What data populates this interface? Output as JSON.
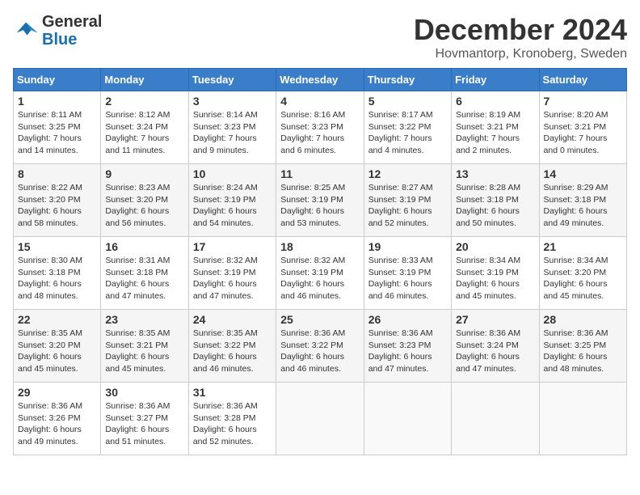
{
  "header": {
    "logo_general": "General",
    "logo_blue": "Blue",
    "month_title": "December 2024",
    "location": "Hovmantorp, Kronoberg, Sweden"
  },
  "days_of_week": [
    "Sunday",
    "Monday",
    "Tuesday",
    "Wednesday",
    "Thursday",
    "Friday",
    "Saturday"
  ],
  "weeks": [
    [
      {
        "day": "1",
        "sunrise": "8:11 AM",
        "sunset": "3:25 PM",
        "daylight_hours": "7",
        "daylight_minutes": "14"
      },
      {
        "day": "2",
        "sunrise": "8:12 AM",
        "sunset": "3:24 PM",
        "daylight_hours": "7",
        "daylight_minutes": "11"
      },
      {
        "day": "3",
        "sunrise": "8:14 AM",
        "sunset": "3:23 PM",
        "daylight_hours": "7",
        "daylight_minutes": "9"
      },
      {
        "day": "4",
        "sunrise": "8:16 AM",
        "sunset": "3:23 PM",
        "daylight_hours": "7",
        "daylight_minutes": "6"
      },
      {
        "day": "5",
        "sunrise": "8:17 AM",
        "sunset": "3:22 PM",
        "daylight_hours": "7",
        "daylight_minutes": "4"
      },
      {
        "day": "6",
        "sunrise": "8:19 AM",
        "sunset": "3:21 PM",
        "daylight_hours": "7",
        "daylight_minutes": "2"
      },
      {
        "day": "7",
        "sunrise": "8:20 AM",
        "sunset": "3:21 PM",
        "daylight_hours": "7",
        "daylight_minutes": "0"
      }
    ],
    [
      {
        "day": "8",
        "sunrise": "8:22 AM",
        "sunset": "3:20 PM",
        "daylight_hours": "6",
        "daylight_minutes": "58"
      },
      {
        "day": "9",
        "sunrise": "8:23 AM",
        "sunset": "3:20 PM",
        "daylight_hours": "6",
        "daylight_minutes": "56"
      },
      {
        "day": "10",
        "sunrise": "8:24 AM",
        "sunset": "3:19 PM",
        "daylight_hours": "6",
        "daylight_minutes": "54"
      },
      {
        "day": "11",
        "sunrise": "8:25 AM",
        "sunset": "3:19 PM",
        "daylight_hours": "6",
        "daylight_minutes": "53"
      },
      {
        "day": "12",
        "sunrise": "8:27 AM",
        "sunset": "3:19 PM",
        "daylight_hours": "6",
        "daylight_minutes": "52"
      },
      {
        "day": "13",
        "sunrise": "8:28 AM",
        "sunset": "3:18 PM",
        "daylight_hours": "6",
        "daylight_minutes": "50"
      },
      {
        "day": "14",
        "sunrise": "8:29 AM",
        "sunset": "3:18 PM",
        "daylight_hours": "6",
        "daylight_minutes": "49"
      }
    ],
    [
      {
        "day": "15",
        "sunrise": "8:30 AM",
        "sunset": "3:18 PM",
        "daylight_hours": "6",
        "daylight_minutes": "48"
      },
      {
        "day": "16",
        "sunrise": "8:31 AM",
        "sunset": "3:18 PM",
        "daylight_hours": "6",
        "daylight_minutes": "47"
      },
      {
        "day": "17",
        "sunrise": "8:32 AM",
        "sunset": "3:19 PM",
        "daylight_hours": "6",
        "daylight_minutes": "47"
      },
      {
        "day": "18",
        "sunrise": "8:32 AM",
        "sunset": "3:19 PM",
        "daylight_hours": "6",
        "daylight_minutes": "46"
      },
      {
        "day": "19",
        "sunrise": "8:33 AM",
        "sunset": "3:19 PM",
        "daylight_hours": "6",
        "daylight_minutes": "46"
      },
      {
        "day": "20",
        "sunrise": "8:34 AM",
        "sunset": "3:19 PM",
        "daylight_hours": "6",
        "daylight_minutes": "45"
      },
      {
        "day": "21",
        "sunrise": "8:34 AM",
        "sunset": "3:20 PM",
        "daylight_hours": "6",
        "daylight_minutes": "45"
      }
    ],
    [
      {
        "day": "22",
        "sunrise": "8:35 AM",
        "sunset": "3:20 PM",
        "daylight_hours": "6",
        "daylight_minutes": "45"
      },
      {
        "day": "23",
        "sunrise": "8:35 AM",
        "sunset": "3:21 PM",
        "daylight_hours": "6",
        "daylight_minutes": "45"
      },
      {
        "day": "24",
        "sunrise": "8:35 AM",
        "sunset": "3:22 PM",
        "daylight_hours": "6",
        "daylight_minutes": "46"
      },
      {
        "day": "25",
        "sunrise": "8:36 AM",
        "sunset": "3:22 PM",
        "daylight_hours": "6",
        "daylight_minutes": "46"
      },
      {
        "day": "26",
        "sunrise": "8:36 AM",
        "sunset": "3:23 PM",
        "daylight_hours": "6",
        "daylight_minutes": "47"
      },
      {
        "day": "27",
        "sunrise": "8:36 AM",
        "sunset": "3:24 PM",
        "daylight_hours": "6",
        "daylight_minutes": "47"
      },
      {
        "day": "28",
        "sunrise": "8:36 AM",
        "sunset": "3:25 PM",
        "daylight_hours": "6",
        "daylight_minutes": "48"
      }
    ],
    [
      {
        "day": "29",
        "sunrise": "8:36 AM",
        "sunset": "3:26 PM",
        "daylight_hours": "6",
        "daylight_minutes": "49"
      },
      {
        "day": "30",
        "sunrise": "8:36 AM",
        "sunset": "3:27 PM",
        "daylight_hours": "6",
        "daylight_minutes": "51"
      },
      {
        "day": "31",
        "sunrise": "8:36 AM",
        "sunset": "3:28 PM",
        "daylight_hours": "6",
        "daylight_minutes": "52"
      },
      null,
      null,
      null,
      null
    ]
  ],
  "labels": {
    "sunrise": "Sunrise:",
    "sunset": "Sunset:",
    "daylight": "Daylight:",
    "hours": "hours",
    "and": "and",
    "minutes": "minutes."
  }
}
